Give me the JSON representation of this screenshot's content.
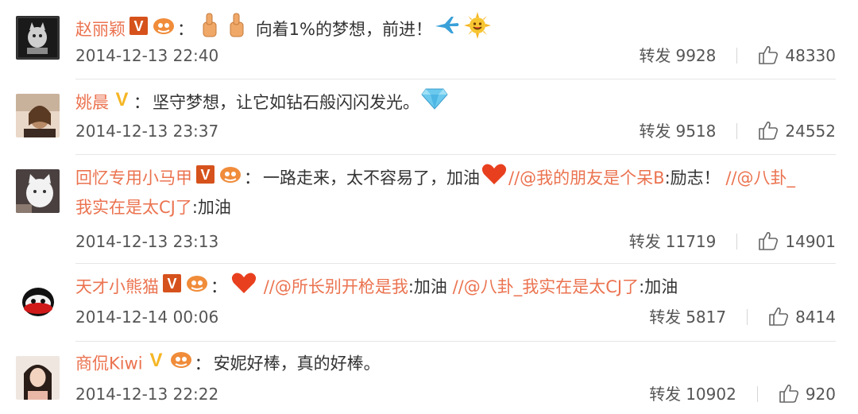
{
  "comments": [
    {
      "username": "赵丽颖",
      "text": "向着1%的梦想，前进！",
      "mentions": [],
      "timestamp": "2014-12-13 22:40",
      "repost_label": "转发",
      "repost_count": "9928",
      "like_count": "48330",
      "avatar_icon": "avatar-cartoon-icon"
    },
    {
      "username": "姚晨",
      "text": "坚守梦想，让它如钻石般闪闪发光。",
      "timestamp": "2014-12-13 23:37",
      "repost_label": "转发",
      "repost_count": "9518",
      "like_count": "24552",
      "avatar_icon": "avatar-photo-icon"
    },
    {
      "username": "回忆专用小马甲",
      "text": "一路走来，太不容易了，加油",
      "forward_prefix": "//",
      "mention_1": "@我的朋友是个呆B",
      "mention_1_text": ":励志！",
      "forward_prefix_2": "//",
      "mention_2a": "@八卦_",
      "mention_2b": "我实在是太CJ了",
      "mention_2_text": ":加油",
      "timestamp": "2014-12-13 23:13",
      "repost_label": "转发",
      "repost_count": "11719",
      "like_count": "14901",
      "avatar_icon": "avatar-cat-icon"
    },
    {
      "username": "天才小熊猫",
      "forward_prefix": "//",
      "mention_1": "@所长别开枪是我",
      "mention_1_text": ":加油",
      "forward_prefix_2": "//",
      "mention_2": "@八卦_我实在是太CJ了",
      "mention_2_text": ":加油",
      "timestamp": "2014-12-14 00:06",
      "repost_label": "转发",
      "repost_count": "5817",
      "like_count": "8414",
      "avatar_icon": "avatar-panda-icon"
    },
    {
      "username": "商侃Kiwi",
      "text": "安妮好棒，真的好棒。",
      "timestamp": "2014-12-13 22:22",
      "repost_label": "转发",
      "repost_count": "10902",
      "like_count": "920",
      "avatar_icon": "avatar-photo-icon"
    }
  ],
  "colors": {
    "username": "#eb7350",
    "text": "#333333",
    "meta": "#555555",
    "verified_red": "#d6521c",
    "verified_yellow": "#f5b625",
    "divider": "#e6e6e6"
  }
}
